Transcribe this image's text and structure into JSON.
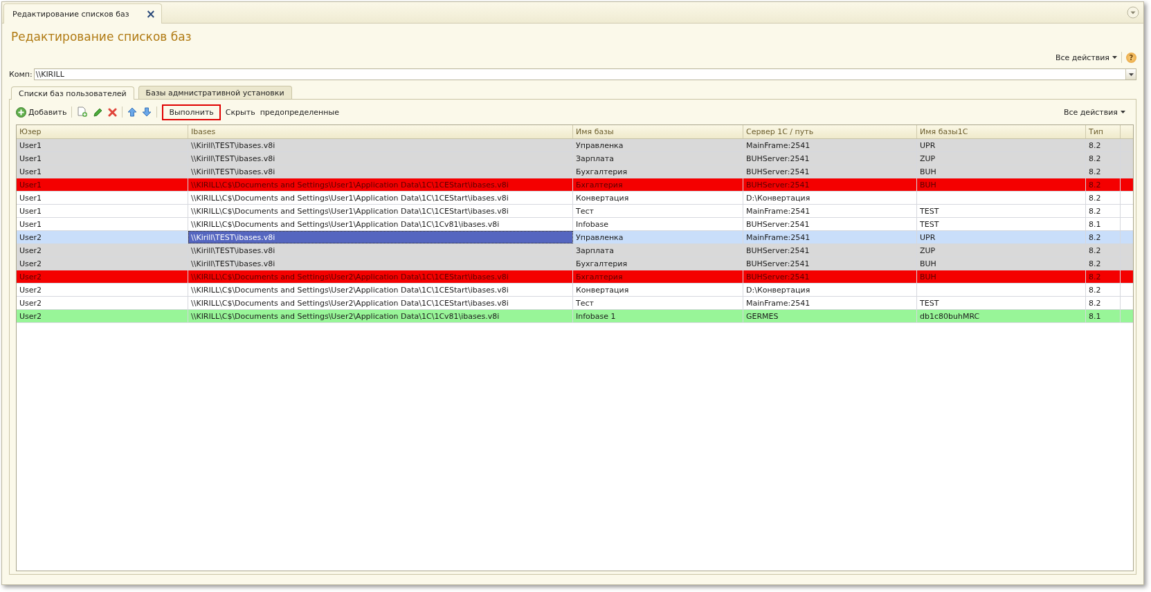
{
  "window_tab": {
    "title": "Редактирование списков баз",
    "close": "×"
  },
  "title": "Редактирование списков баз",
  "top_actions": {
    "label": "Все действия",
    "help": "?"
  },
  "computer_field": {
    "label": "Комп:",
    "value": "\\\\KIRILL"
  },
  "tabs": [
    {
      "label": "Списки баз пользователей",
      "selected": true
    },
    {
      "label": "Базы адмнистративной установки",
      "selected": false
    }
  ],
  "toolbar": {
    "add": "Добавить",
    "run": "Выполнить",
    "hide": "Скрыть  предопределенные",
    "all_actions": "Все действия"
  },
  "table": {
    "columns": [
      "Юзер",
      "Ibases",
      "Имя базы",
      "Сервер 1С / путь",
      "Имя базы1С",
      "Тип"
    ],
    "rows": [
      {
        "cells": [
          "User1",
          "\\\\Kirill\\TEST\\ibases.v8i",
          "Управленка",
          "MainFrame:2541",
          "UPR",
          "8.2"
        ],
        "color": "#d9d9d9",
        "selected": false
      },
      {
        "cells": [
          "User1",
          "\\\\Kirill\\TEST\\ibases.v8i",
          "Зарплата",
          "BUHServer:2541",
          "ZUP",
          "8.2"
        ],
        "color": "#d9d9d9",
        "selected": false
      },
      {
        "cells": [
          "User1",
          "\\\\Kirill\\TEST\\ibases.v8i",
          "Бухгалтерия",
          "BUHServer:2541",
          "BUH",
          "8.2"
        ],
        "color": "#d9d9d9",
        "selected": false
      },
      {
        "cells": [
          "User1",
          "\\\\KIRILL\\C$\\Documents and Settings\\User1\\Application Data\\1C\\1CEStart\\ibases.v8i",
          "Бхгалтерия",
          "BUHServer:2541",
          "BUH",
          "8.2"
        ],
        "color": "#f40000",
        "selected": false
      },
      {
        "cells": [
          "User1",
          "\\\\KIRILL\\C$\\Documents and Settings\\User1\\Application Data\\1C\\1CEStart\\ibases.v8i",
          "Конвертация",
          "D:\\Конвертация",
          "",
          "8.2"
        ],
        "color": "#ffffff",
        "selected": false
      },
      {
        "cells": [
          "User1",
          "\\\\KIRILL\\C$\\Documents and Settings\\User1\\Application Data\\1C\\1CEStart\\ibases.v8i",
          "Тест",
          "MainFrame:2541",
          "TEST",
          "8.2"
        ],
        "color": "#ffffff",
        "selected": false
      },
      {
        "cells": [
          "User1",
          "\\\\KIRILL\\C$\\Documents and Settings\\User1\\Application Data\\1C\\1Cv81\\ibases.v8i",
          "Infobase",
          "BUHServer:2541",
          "TEST",
          "8.1"
        ],
        "color": "#ffffff",
        "selected": false
      },
      {
        "cells": [
          "User2",
          "\\\\Kirill\\TEST\\ibases.v8i",
          "Управленка",
          "MainFrame:2541",
          "UPR",
          "8.2"
        ],
        "color": "#d9d9d9",
        "selected": true
      },
      {
        "cells": [
          "User2",
          "\\\\Kirill\\TEST\\ibases.v8i",
          "Зарплата",
          "BUHServer:2541",
          "ZUP",
          "8.2"
        ],
        "color": "#d9d9d9",
        "selected": false
      },
      {
        "cells": [
          "User2",
          "\\\\Kirill\\TEST\\ibases.v8i",
          "Бухгалтерия",
          "BUHServer:2541",
          "BUH",
          "8.2"
        ],
        "color": "#d9d9d9",
        "selected": false
      },
      {
        "cells": [
          "User2",
          "\\\\KIRILL\\C$\\Documents and Settings\\User2\\Application Data\\1C\\1CEStart\\ibases.v8i",
          "Бхгалтерия",
          "BUHServer:2541",
          "BUH",
          "8.2"
        ],
        "color": "#f40000",
        "selected": false
      },
      {
        "cells": [
          "User2",
          "\\\\KIRILL\\C$\\Documents and Settings\\User2\\Application Data\\1C\\1CEStart\\ibases.v8i",
          "Конвертация",
          "D:\\Конвертация",
          "",
          "8.2"
        ],
        "color": "#ffffff",
        "selected": false
      },
      {
        "cells": [
          "User2",
          "\\\\KIRILL\\C$\\Documents and Settings\\User2\\Application Data\\1C\\1CEStart\\ibases.v8i",
          "Тест",
          "MainFrame:2541",
          "TEST",
          "8.2"
        ],
        "color": "#ffffff",
        "selected": false
      },
      {
        "cells": [
          "User2",
          "\\\\KIRILL\\C$\\Documents and Settings\\User2\\Application Data\\1C\\1Cv81\\ibases.v8i",
          "Infobase 1",
          "GERMES",
          "db1c80buhMRC",
          "8.1"
        ],
        "color": "#98f598",
        "selected": false
      }
    ]
  }
}
